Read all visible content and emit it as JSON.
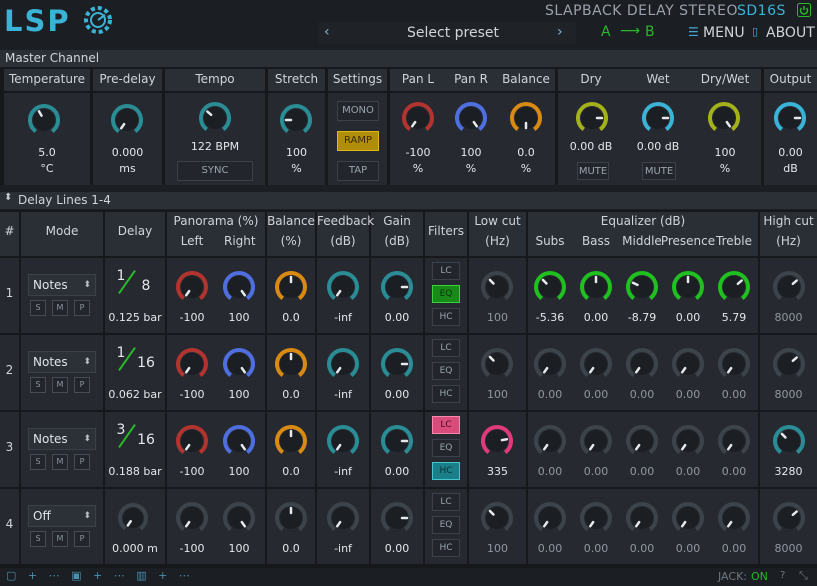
{
  "header": {
    "logo": "LSP",
    "plugin_name": "SLAPBACK DELAY STEREO",
    "plugin_code": "SD16S",
    "preset": "Select preset",
    "ab_a": "A",
    "ab_b": "B",
    "menu": "MENU",
    "about": "ABOUT"
  },
  "master": {
    "title": "Master Channel",
    "labels": {
      "temperature": "Temperature",
      "predelay": "Pre-delay",
      "tempo": "Tempo",
      "stretch": "Stretch",
      "settings": "Settings",
      "panl": "Pan L",
      "panr": "Pan R",
      "balance": "Balance",
      "dry": "Dry",
      "wet": "Wet",
      "drywet": "Dry/Wet",
      "output": "Output"
    },
    "temperature": {
      "value": "5.0",
      "unit": "°C"
    },
    "predelay": {
      "value": "0.000",
      "unit": "ms"
    },
    "tempo": {
      "value": "122 BPM",
      "sync": "SYNC"
    },
    "stretch": {
      "value": "100",
      "unit": "%"
    },
    "settings": {
      "mono": "MONO",
      "ramp": "RAMP",
      "tap": "TAP"
    },
    "panl": {
      "value": "-100",
      "unit": "%"
    },
    "panr": {
      "value": "100",
      "unit": "%"
    },
    "balance": {
      "value": "0.0",
      "unit": "%"
    },
    "dry": {
      "value": "0.00 dB",
      "mute": "MUTE"
    },
    "wet": {
      "value": "0.00 dB",
      "mute": "MUTE"
    },
    "drywet": {
      "value": "100",
      "unit": "%"
    },
    "output": {
      "value": "0.00",
      "unit": "dB"
    }
  },
  "delay_lines": {
    "title": "Delay Lines 1-4",
    "headers": {
      "num": "#",
      "mode": "Mode",
      "delay": "Delay",
      "panorama": "Panorama (%)",
      "left": "Left",
      "right": "Right",
      "balance": "Balance",
      "balance_unit": "(%)",
      "feedback": "Feedback",
      "feedback_unit": "(dB)",
      "gain": "Gain",
      "gain_unit": "(dB)",
      "filters": "Filters",
      "lowcut": "Low cut",
      "lowcut_unit": "(Hz)",
      "equalizer": "Equalizer (dB)",
      "subs": "Subs",
      "bass": "Bass",
      "middle": "Middle",
      "presence": "Presence",
      "treble": "Treble",
      "highcut": "High cut",
      "highcut_unit": "(Hz)"
    },
    "filter_labels": {
      "lc": "LC",
      "eq": "EQ",
      "hc": "HC"
    },
    "smp": {
      "s": "S",
      "m": "M",
      "p": "P"
    },
    "rows": [
      {
        "num": "1",
        "mode": "Notes",
        "frac_num": "1",
        "frac_den": "8",
        "delay": "0.125 bar",
        "left": "-100",
        "right": "100",
        "balance": "0.0",
        "feedback": "-inf",
        "gain": "0.00",
        "lowcut": "100",
        "subs": "-5.36",
        "bass": "0.00",
        "middle": "-8.79",
        "presence": "0.00",
        "treble": "5.79",
        "highcut": "8000"
      },
      {
        "num": "2",
        "mode": "Notes",
        "frac_num": "1",
        "frac_den": "16",
        "delay": "0.062 bar",
        "left": "-100",
        "right": "100",
        "balance": "0.0",
        "feedback": "-inf",
        "gain": "0.00",
        "lowcut": "100",
        "subs": "0.00",
        "bass": "0.00",
        "middle": "0.00",
        "presence": "0.00",
        "treble": "0.00",
        "highcut": "8000"
      },
      {
        "num": "3",
        "mode": "Notes",
        "frac_num": "3",
        "frac_den": "16",
        "delay": "0.188 bar",
        "left": "-100",
        "right": "100",
        "balance": "0.0",
        "feedback": "-inf",
        "gain": "0.00",
        "lowcut": "335",
        "subs": "0.00",
        "bass": "0.00",
        "middle": "0.00",
        "presence": "0.00",
        "treble": "0.00",
        "highcut": "3280"
      },
      {
        "num": "4",
        "mode": "Off",
        "delay": "0.000 m",
        "left": "-100",
        "right": "100",
        "balance": "0.0",
        "feedback": "-inf",
        "gain": "0.00",
        "lowcut": "100",
        "subs": "0.00",
        "bass": "0.00",
        "middle": "0.00",
        "presence": "0.00",
        "treble": "0.00",
        "highcut": "8000"
      }
    ]
  },
  "footer": {
    "jack": "JACK:",
    "jack_status": "ON"
  },
  "colors": {
    "accent": "#3bb3d6",
    "teal": "#2a8d96",
    "red": "#b3342f",
    "blue": "#4f6fe0",
    "orange": "#d98a13",
    "olive": "#a3b21a",
    "green": "#1fc01f",
    "pink": "#e03a7a",
    "gray": "#8b929b"
  }
}
